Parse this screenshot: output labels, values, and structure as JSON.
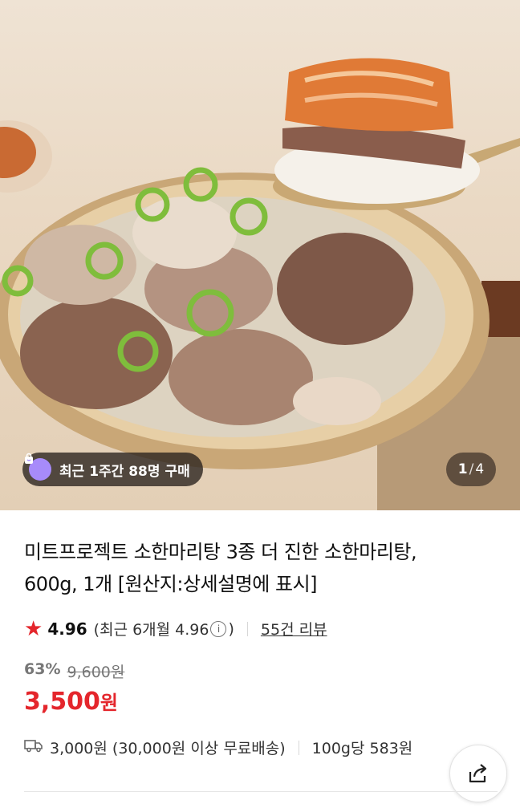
{
  "hero": {
    "badge": {
      "icon": "shopping-bag-icon",
      "text": "최근 1주간 88명 구매"
    },
    "counter": {
      "current": "1",
      "separator": "/",
      "total": "4"
    }
  },
  "product": {
    "title_line1": "미트프로젝트 소한마리탕 3종 더 진한 소한마리탕,",
    "title_line2": "600g, 1개 [원산지:상세설명에 표시]",
    "rating": {
      "score": "4.96",
      "recent_open": "(최근 6개월 4.96",
      "recent_close": ")",
      "info_icon": "i",
      "review_link": "55건 리뷰"
    },
    "discount_percent": "63%",
    "original_price": "9,600원",
    "price": "3,500",
    "price_unit": "원",
    "shipping": {
      "fee": "3,000원 (30,000원 이상 무료배송)",
      "unit_price": "100g당 583원"
    }
  },
  "colors": {
    "accent": "#e4262c",
    "badge_icon": "#a78bfa"
  }
}
